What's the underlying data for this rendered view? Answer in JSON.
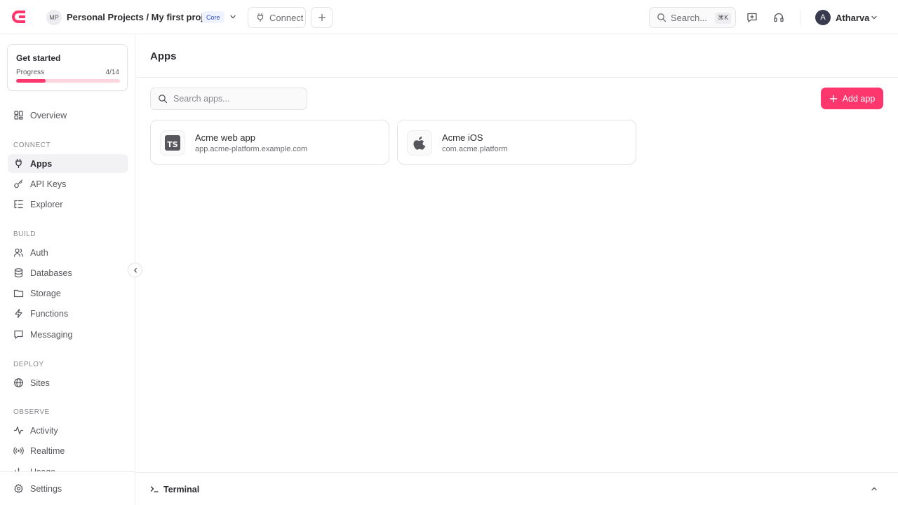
{
  "topbar": {
    "org_initials": "MP",
    "breadcrumb": "Personal Projects / My first project",
    "tier_badge": "Core",
    "connect_label": "Connect",
    "search_label": "Search...",
    "search_shortcut": "⌘K",
    "user_initial": "A",
    "user_name": "Atharva"
  },
  "progress": {
    "title": "Get started",
    "label": "Progress",
    "count": "4/14",
    "fraction": 0.2857
  },
  "sidebar": {
    "overview": "Overview",
    "sections": {
      "connect": "CONNECT",
      "build": "BUILD",
      "deploy": "DEPLOY",
      "observe": "OBSERVE"
    },
    "items": {
      "apps": "Apps",
      "api_keys": "API Keys",
      "explorer": "Explorer",
      "auth": "Auth",
      "databases": "Databases",
      "storage": "Storage",
      "functions": "Functions",
      "messaging": "Messaging",
      "sites": "Sites",
      "activity": "Activity",
      "realtime": "Realtime",
      "usage": "Usage",
      "settings": "Settings"
    },
    "active": "apps"
  },
  "main": {
    "title": "Apps",
    "search_placeholder": "Search apps...",
    "add_label": "Add app",
    "apps": [
      {
        "name": "Acme web app",
        "id": "app.acme-platform.example.com",
        "icon": "typescript-icon"
      },
      {
        "name": "Acme iOS",
        "id": "com.acme.platform",
        "icon": "apple-icon"
      }
    ]
  },
  "terminal": {
    "label": "Terminal"
  },
  "colors": {
    "accent": "#fd366e",
    "accent_track": "#fcd5df",
    "border": "#e3e3e6",
    "text": "#2d2d31"
  }
}
